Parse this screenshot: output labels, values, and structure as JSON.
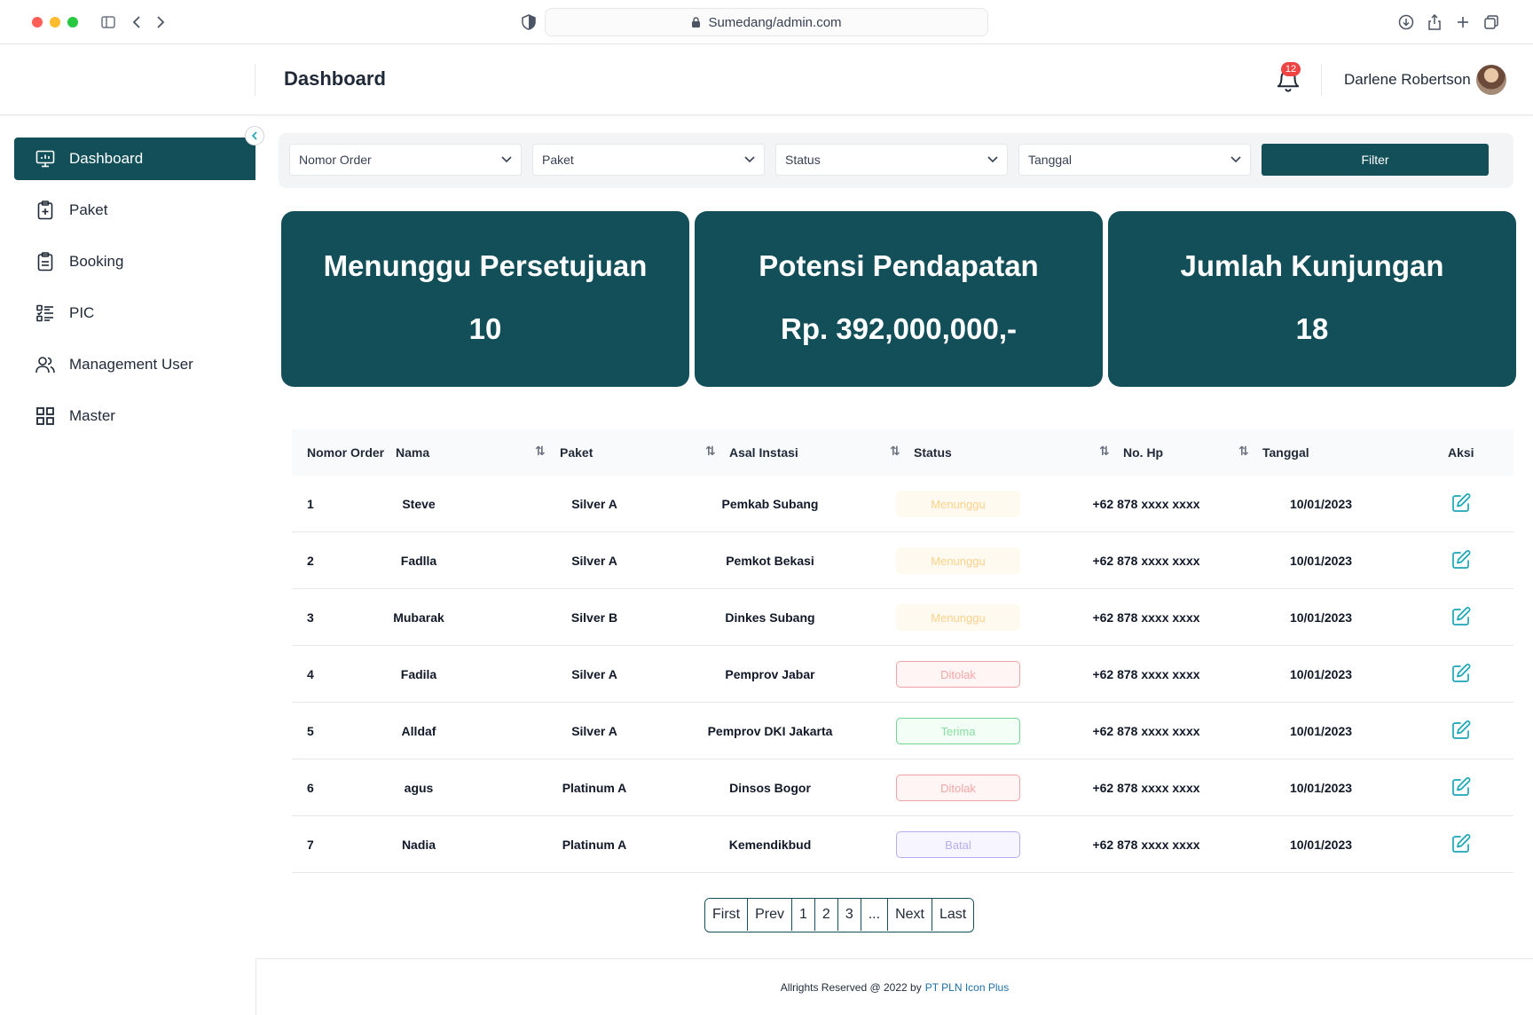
{
  "browser": {
    "url": "Sumedang/admin.com"
  },
  "header": {
    "title": "Dashboard",
    "notification_count": "12",
    "user_name": "Darlene Robertson"
  },
  "sidebar": {
    "items": [
      {
        "label": "Dashboard",
        "icon": "monitor-icon",
        "active": true
      },
      {
        "label": "Paket",
        "icon": "clipboard-plus-icon",
        "active": false
      },
      {
        "label": "Booking",
        "icon": "clipboard-list-icon",
        "active": false
      },
      {
        "label": "PIC",
        "icon": "list-check-icon",
        "active": false
      },
      {
        "label": "Management User",
        "icon": "users-icon",
        "active": false
      },
      {
        "label": "Master",
        "icon": "grid-icon",
        "active": false
      }
    ]
  },
  "filters": {
    "selects": [
      "Nomor Order",
      "Paket",
      "Status",
      "Tanggal"
    ],
    "button_label": "Filter"
  },
  "stats": [
    {
      "title": "Menunggu Persetujuan",
      "value": "10"
    },
    {
      "title": "Potensi Pendapatan",
      "value": "Rp. 392,000,000,-"
    },
    {
      "title": "Jumlah Kunjungan",
      "value": "18"
    }
  ],
  "table": {
    "headers": [
      "Nomor Order",
      "Nama",
      "Paket",
      "Asal Instasi",
      "Status",
      "No. Hp",
      "Tanggal",
      "Aksi"
    ],
    "rows": [
      {
        "no": "1",
        "nama": "Steve",
        "paket": "Silver A",
        "asal": "Pemkab Subang",
        "status": "Menunggu",
        "hp": "+62 878 xxxx xxxx",
        "tanggal": "10/01/2023"
      },
      {
        "no": "2",
        "nama": "Fadlla",
        "paket": "Silver A",
        "asal": "Pemkot Bekasi",
        "status": "Menunggu",
        "hp": "+62 878 xxxx xxxx",
        "tanggal": "10/01/2023"
      },
      {
        "no": "3",
        "nama": "Mubarak",
        "paket": "Silver B",
        "asal": "Dinkes Subang",
        "status": "Menunggu",
        "hp": "+62 878 xxxx xxxx",
        "tanggal": "10/01/2023"
      },
      {
        "no": "4",
        "nama": "Fadila",
        "paket": "Silver A",
        "asal": "Pemprov Jabar",
        "status": "Ditolak",
        "hp": "+62 878 xxxx xxxx",
        "tanggal": "10/01/2023"
      },
      {
        "no": "5",
        "nama": "Alldaf",
        "paket": "Silver A",
        "asal": "Pemprov DKI Jakarta",
        "status": "Terima",
        "hp": "+62 878 xxxx xxxx",
        "tanggal": "10/01/2023"
      },
      {
        "no": "6",
        "nama": "agus",
        "paket": "Platinum A",
        "asal": "Dinsos Bogor",
        "status": "Ditolak",
        "hp": "+62 878 xxxx xxxx",
        "tanggal": "10/01/2023"
      },
      {
        "no": "7",
        "nama": "Nadia",
        "paket": "Platinum A",
        "asal": "Kemendikbud",
        "status": "Batal",
        "hp": "+62 878 xxxx xxxx",
        "tanggal": "10/01/2023"
      }
    ]
  },
  "pagination": [
    "First",
    "Prev",
    "1",
    "2",
    "3",
    "...",
    "Next",
    "Last"
  ],
  "footer": {
    "text": "Allrights Reserved @ 2022 by",
    "link": "PT PLN Icon Plus"
  },
  "colors": {
    "primary": "#124f58",
    "accent": "#1aa6b7",
    "badge_count": "#ef4444"
  }
}
